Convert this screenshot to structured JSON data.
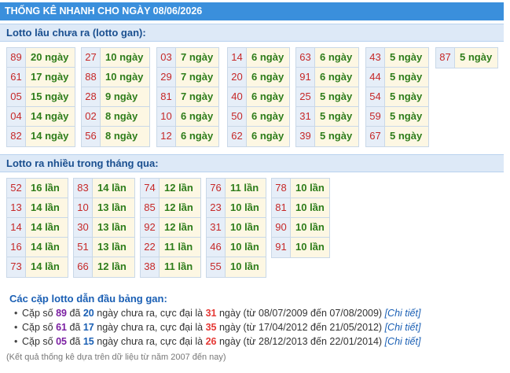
{
  "title": "THỐNG KÊ NHANH CHO NGÀY 08/06/2026",
  "gan": {
    "heading": "Lotto lâu chưa ra (lotto gan):",
    "columns": [
      [
        [
          "89",
          "20 ngày"
        ],
        [
          "61",
          "17 ngày"
        ],
        [
          "05",
          "15 ngày"
        ],
        [
          "04",
          "14 ngày"
        ],
        [
          "82",
          "14 ngày"
        ]
      ],
      [
        [
          "27",
          "10 ngày"
        ],
        [
          "88",
          "10 ngày"
        ],
        [
          "28",
          "9 ngày"
        ],
        [
          "02",
          "8 ngày"
        ],
        [
          "56",
          "8 ngày"
        ]
      ],
      [
        [
          "03",
          "7 ngày"
        ],
        [
          "29",
          "7 ngày"
        ],
        [
          "81",
          "7 ngày"
        ],
        [
          "10",
          "6 ngày"
        ],
        [
          "12",
          "6 ngày"
        ]
      ],
      [
        [
          "14",
          "6 ngày"
        ],
        [
          "20",
          "6 ngày"
        ],
        [
          "40",
          "6 ngày"
        ],
        [
          "50",
          "6 ngày"
        ],
        [
          "62",
          "6 ngày"
        ]
      ],
      [
        [
          "63",
          "6 ngày"
        ],
        [
          "91",
          "6 ngày"
        ],
        [
          "25",
          "5 ngày"
        ],
        [
          "31",
          "5 ngày"
        ],
        [
          "39",
          "5 ngày"
        ]
      ],
      [
        [
          "43",
          "5 ngày"
        ],
        [
          "44",
          "5 ngày"
        ],
        [
          "54",
          "5 ngày"
        ],
        [
          "59",
          "5 ngày"
        ],
        [
          "67",
          "5 ngày"
        ]
      ],
      [
        [
          "87",
          "5 ngày"
        ]
      ]
    ]
  },
  "frequent": {
    "heading": "Lotto ra nhiều trong tháng qua:",
    "columns": [
      [
        [
          "52",
          "16 lần"
        ],
        [
          "13",
          "14 lần"
        ],
        [
          "14",
          "14 lần"
        ],
        [
          "16",
          "14 lần"
        ],
        [
          "73",
          "14 lần"
        ]
      ],
      [
        [
          "83",
          "14 lần"
        ],
        [
          "10",
          "13 lần"
        ],
        [
          "30",
          "13 lần"
        ],
        [
          "51",
          "13 lần"
        ],
        [
          "66",
          "12 lần"
        ]
      ],
      [
        [
          "74",
          "12 lần"
        ],
        [
          "85",
          "12 lần"
        ],
        [
          "92",
          "12 lần"
        ],
        [
          "22",
          "11 lần"
        ],
        [
          "38",
          "11 lần"
        ]
      ],
      [
        [
          "76",
          "11 lần"
        ],
        [
          "23",
          "10 lần"
        ],
        [
          "31",
          "10 lần"
        ],
        [
          "46",
          "10 lần"
        ],
        [
          "55",
          "10 lần"
        ]
      ],
      [
        [
          "78",
          "10 lần"
        ],
        [
          "81",
          "10 lần"
        ],
        [
          "90",
          "10 lần"
        ],
        [
          "91",
          "10 lần"
        ]
      ]
    ]
  },
  "pairs": {
    "heading": "Các cặp lotto dẫn đầu bảng gan:",
    "items": [
      {
        "prefix": "Cặp số",
        "num": "89",
        "mid1": "đã",
        "days": "20",
        "mid2": "ngày chưa ra, cực đại là",
        "max": "31",
        "suffix": "ngày (từ 08/07/2009 đến 07/08/2009)",
        "link": "[Chi tiết]"
      },
      {
        "prefix": "Cặp số",
        "num": "61",
        "mid1": "đã",
        "days": "17",
        "mid2": "ngày chưa ra, cực đại là",
        "max": "35",
        "suffix": "ngày (từ 17/04/2012 đến 21/05/2012)",
        "link": "[Chi tiết]"
      },
      {
        "prefix": "Cặp số",
        "num": "05",
        "mid1": "đã",
        "days": "15",
        "mid2": "ngày chưa ra, cực đại là",
        "max": "26",
        "suffix": "ngày (từ 28/12/2013 đến 22/01/2014)",
        "link": "[Chi tiết]"
      }
    ]
  },
  "note": "(Kết quả thống kê dựa trên dữ liệu từ năm 2007 đến nay)",
  "colors": {
    "header": "#3a8fdc",
    "number": "#c62828",
    "count": "#2e7d1a",
    "cell": "#fdf7e3",
    "numcell": "#e6eef8"
  }
}
